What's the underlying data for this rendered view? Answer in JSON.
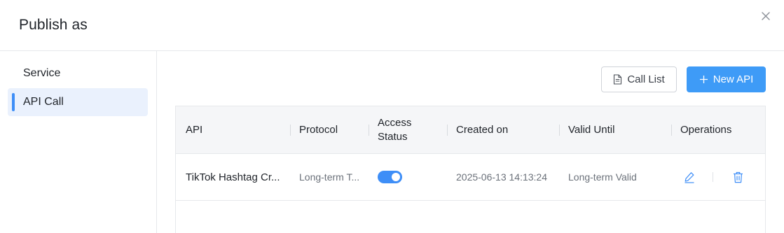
{
  "dialog": {
    "title": "Publish as"
  },
  "sidebar": {
    "items": [
      {
        "label": "Service",
        "active": false
      },
      {
        "label": "API Call",
        "active": true
      }
    ]
  },
  "toolbar": {
    "call_list_label": "Call List",
    "new_api_label": "New API"
  },
  "table": {
    "headers": {
      "api": "API",
      "protocol": "Protocol",
      "access_status_line1": "Access",
      "access_status_line2": "Status",
      "created_on": "Created on",
      "valid_until": "Valid Until",
      "operations": "Operations"
    },
    "rows": [
      {
        "api": "TikTok Hashtag Cr...",
        "protocol": "Long-term T...",
        "access_status": true,
        "created_on": "2025-06-13 14:13:24",
        "valid_until": "Long-term Valid"
      }
    ]
  },
  "colors": {
    "accent": "#3e8ef7",
    "primary_button": "#3e9bf7",
    "icon_blue": "#3e8ef7"
  },
  "icons": {
    "close": "close-icon",
    "document": "document-icon",
    "plus": "plus-icon",
    "edit": "edit-icon",
    "delete": "trash-icon"
  }
}
